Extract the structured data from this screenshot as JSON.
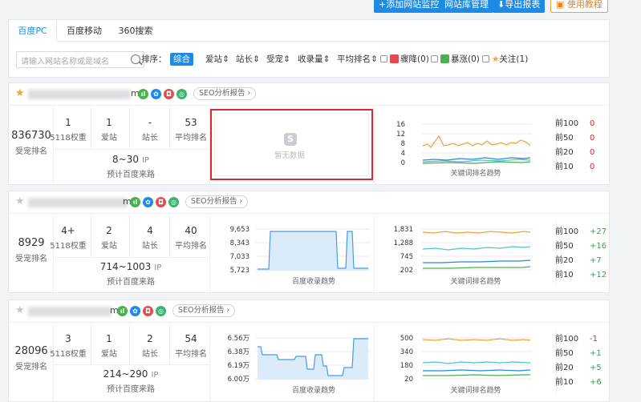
{
  "toolbar": {
    "add_monitor": "+添加网站监控",
    "site_library": "网站库管理",
    "export": "导出报表",
    "tutorial": "使用教程"
  },
  "tabs": [
    "百度PC",
    "百度移动",
    "360搜索"
  ],
  "search": {
    "placeholder": "请输入网站名称或是域名"
  },
  "filters": {
    "sort_label": "排序：",
    "sorts": [
      "综合",
      "爱站",
      "站长",
      "受宠",
      "收录量",
      "平均排名"
    ],
    "drop": "骤降(0)",
    "rise": "暴涨(0)",
    "follow": "关注(1)"
  },
  "labels": {
    "rank": "受宠排名",
    "weight": "5118权重",
    "aizhan": "爱站",
    "zhanzhang": "站长",
    "avg": "平均排名",
    "ip_unit": "IP",
    "traffic": "预计百度来路",
    "seo_report": "SEO分析报告",
    "no_data": "暂无数据",
    "index_trend": "百度收录趋势",
    "kw_trend": "关键词排名趋势",
    "rank_keys": [
      "前100",
      "前50",
      "前20",
      "前10"
    ]
  },
  "sites": [
    {
      "domain_tail": "m",
      "rank": "836730",
      "weight": "1",
      "aizhan": "1",
      "zhanzhang": "-",
      "avg": "53",
      "ip": "8~30",
      "rank_vals": [
        "0",
        "0",
        "0",
        "0"
      ],
      "index_axis": [],
      "kw_axis": [
        "16",
        "12",
        "8",
        "4",
        "0"
      ]
    },
    {
      "domain_tail": "m",
      "rank": "8929",
      "weight": "4+",
      "aizhan": "2",
      "zhanzhang": "4",
      "avg": "40",
      "ip": "714~1003",
      "rank_vals": [
        "+27",
        "+16",
        "+7",
        "+12"
      ],
      "index_axis": [
        "9,653",
        "8,343",
        "7,033",
        "5,723"
      ],
      "kw_axis": [
        "1,831",
        "1,288",
        "745",
        "202"
      ]
    },
    {
      "domain_tail": "m",
      "rank": "28096",
      "weight": "3",
      "aizhan": "1",
      "zhanzhang": "2",
      "avg": "54",
      "ip": "214~290",
      "rank_vals": [
        "-1",
        "+1",
        "+5",
        "+6"
      ],
      "index_axis": [
        "6.56万",
        "6.38万",
        "6.19万",
        "6.00万"
      ],
      "kw_axis": [
        "500",
        "340",
        "180",
        "20"
      ]
    }
  ],
  "colors": {
    "accent": "#1d8ae6",
    "red": "#d9292e",
    "green": "#2fa84f",
    "orange": "#f0a23a"
  }
}
